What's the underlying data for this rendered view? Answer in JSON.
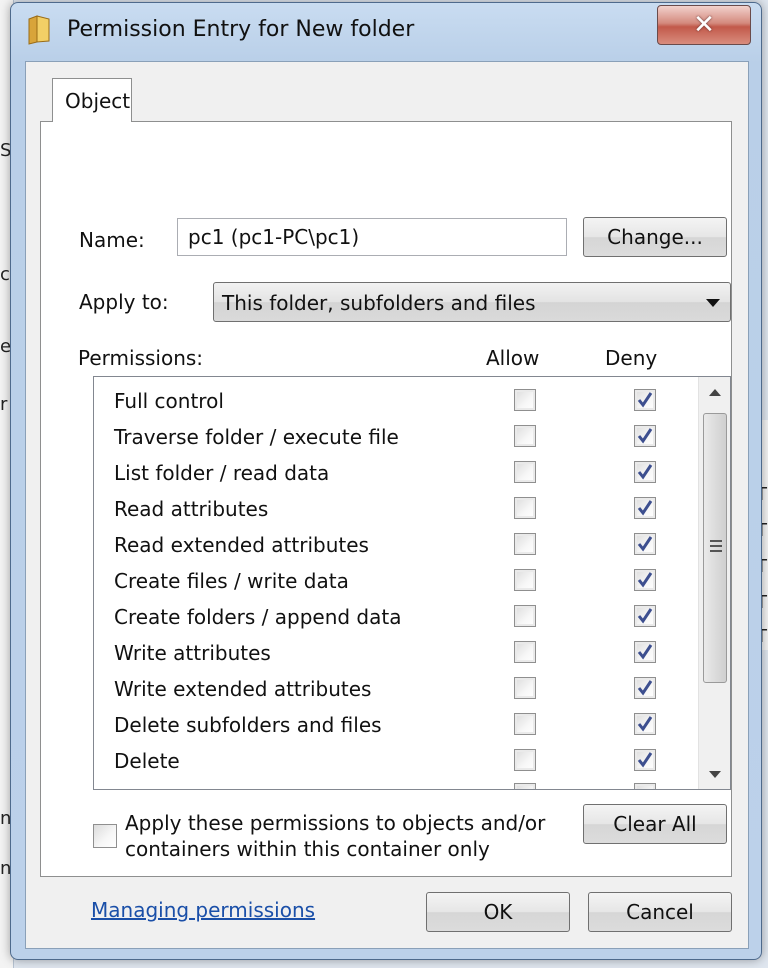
{
  "window": {
    "title": "Permission Entry for New folder",
    "close_glyph": "✕"
  },
  "tab": {
    "label": "Object"
  },
  "name": {
    "label": "Name:",
    "value": "pc1 (pc1-PC\\pc1)",
    "change_button": "Change..."
  },
  "apply_to": {
    "label": "Apply to:",
    "selected": "This folder, subfolders and files"
  },
  "permissions": {
    "header": "Permissions:",
    "allow_header": "Allow",
    "deny_header": "Deny",
    "rows": [
      {
        "name": "Full control",
        "allow": false,
        "deny": true
      },
      {
        "name": "Traverse folder / execute file",
        "allow": false,
        "deny": true
      },
      {
        "name": "List folder / read data",
        "allow": false,
        "deny": true
      },
      {
        "name": "Read attributes",
        "allow": false,
        "deny": true
      },
      {
        "name": "Read extended attributes",
        "allow": false,
        "deny": true
      },
      {
        "name": "Create files / write data",
        "allow": false,
        "deny": true
      },
      {
        "name": "Create folders / append data",
        "allow": false,
        "deny": true
      },
      {
        "name": "Write attributes",
        "allow": false,
        "deny": true
      },
      {
        "name": "Write extended attributes",
        "allow": false,
        "deny": true
      },
      {
        "name": "Delete subfolders and files",
        "allow": false,
        "deny": true
      },
      {
        "name": "Delete",
        "allow": false,
        "deny": true
      }
    ]
  },
  "apply_only": {
    "label": "Apply these permissions to objects and/or containers within this container only",
    "checked": false
  },
  "clear_all_button": "Clear All",
  "managing_link": "Managing permissions",
  "ok_button": "OK",
  "cancel_button": "Cancel",
  "icons": {
    "title": "folder-icon",
    "dropdown": "dropdown-arrow-icon",
    "check": "checkmark-icon"
  },
  "colors": {
    "link": "#1a4fa8",
    "check": "#3d4f8f"
  }
}
